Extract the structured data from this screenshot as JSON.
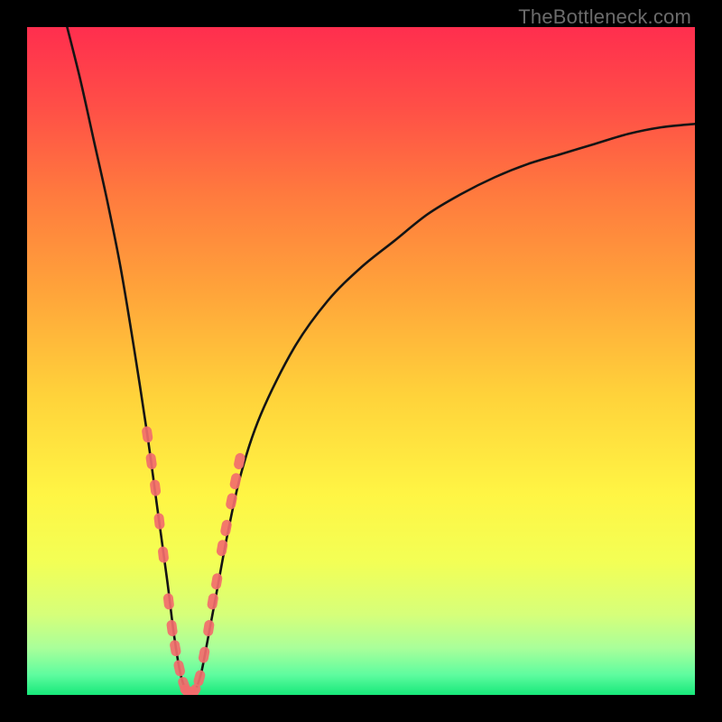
{
  "watermark": {
    "text": "TheBottleneck.com"
  },
  "colors": {
    "black": "#000000",
    "gradient_stops": [
      {
        "offset": 0.0,
        "color": "#ff2e4e"
      },
      {
        "offset": 0.12,
        "color": "#ff4f47"
      },
      {
        "offset": 0.25,
        "color": "#ff7a3e"
      },
      {
        "offset": 0.4,
        "color": "#ffa53a"
      },
      {
        "offset": 0.55,
        "color": "#ffd23a"
      },
      {
        "offset": 0.7,
        "color": "#fff544"
      },
      {
        "offset": 0.8,
        "color": "#f3ff55"
      },
      {
        "offset": 0.88,
        "color": "#d6ff7a"
      },
      {
        "offset": 0.93,
        "color": "#a9ff9a"
      },
      {
        "offset": 0.97,
        "color": "#5efc9f"
      },
      {
        "offset": 1.0,
        "color": "#17e87a"
      }
    ],
    "curve_stroke": "#141414",
    "marker_fill": "#f26d6d",
    "marker_stroke": "#f26d6d"
  },
  "chart_data": {
    "type": "line",
    "title": "",
    "xlabel": "",
    "ylabel": "",
    "xlim": [
      0,
      100
    ],
    "ylim": [
      0,
      100
    ],
    "note": "Bottleneck curve — y is bottleneck %, x is relative hardware balance. Minimum ~0% at x≈24. Curve rises steeply to the left and more gradually to the right. Values estimated from pixel positions.",
    "series": [
      {
        "name": "bottleneck-curve",
        "x": [
          6,
          8,
          10,
          12,
          14,
          16,
          18,
          19.5,
          21,
          22,
          23,
          24,
          25,
          26,
          27,
          28.5,
          30,
          32,
          35,
          40,
          45,
          50,
          55,
          60,
          65,
          70,
          75,
          80,
          85,
          90,
          95,
          100
        ],
        "y": [
          100,
          92,
          83,
          74,
          64,
          52,
          39,
          28,
          17,
          9,
          3,
          0.5,
          0.5,
          3,
          8,
          16,
          24,
          33,
          42,
          52,
          59,
          64,
          68,
          72,
          75,
          77.5,
          79.5,
          81,
          82.5,
          84,
          85,
          85.5
        ]
      }
    ],
    "markers": {
      "name": "highlighted-points",
      "note": "Pink capsule markers clustered along both arms near the minimum and a short flat segment at the bottom.",
      "points": [
        {
          "x": 18.0,
          "y": 39
        },
        {
          "x": 18.6,
          "y": 35
        },
        {
          "x": 19.2,
          "y": 31
        },
        {
          "x": 19.8,
          "y": 26
        },
        {
          "x": 20.4,
          "y": 21
        },
        {
          "x": 21.2,
          "y": 14
        },
        {
          "x": 21.7,
          "y": 10
        },
        {
          "x": 22.2,
          "y": 7
        },
        {
          "x": 22.8,
          "y": 4
        },
        {
          "x": 23.5,
          "y": 1.5
        },
        {
          "x": 24.0,
          "y": 0.5
        },
        {
          "x": 24.5,
          "y": 0.5
        },
        {
          "x": 25.0,
          "y": 0.5
        },
        {
          "x": 25.8,
          "y": 2.5
        },
        {
          "x": 26.5,
          "y": 6
        },
        {
          "x": 27.2,
          "y": 10
        },
        {
          "x": 27.8,
          "y": 14
        },
        {
          "x": 28.4,
          "y": 17
        },
        {
          "x": 29.2,
          "y": 22
        },
        {
          "x": 29.8,
          "y": 25
        },
        {
          "x": 30.6,
          "y": 29
        },
        {
          "x": 31.2,
          "y": 32
        },
        {
          "x": 31.8,
          "y": 35
        }
      ]
    }
  }
}
